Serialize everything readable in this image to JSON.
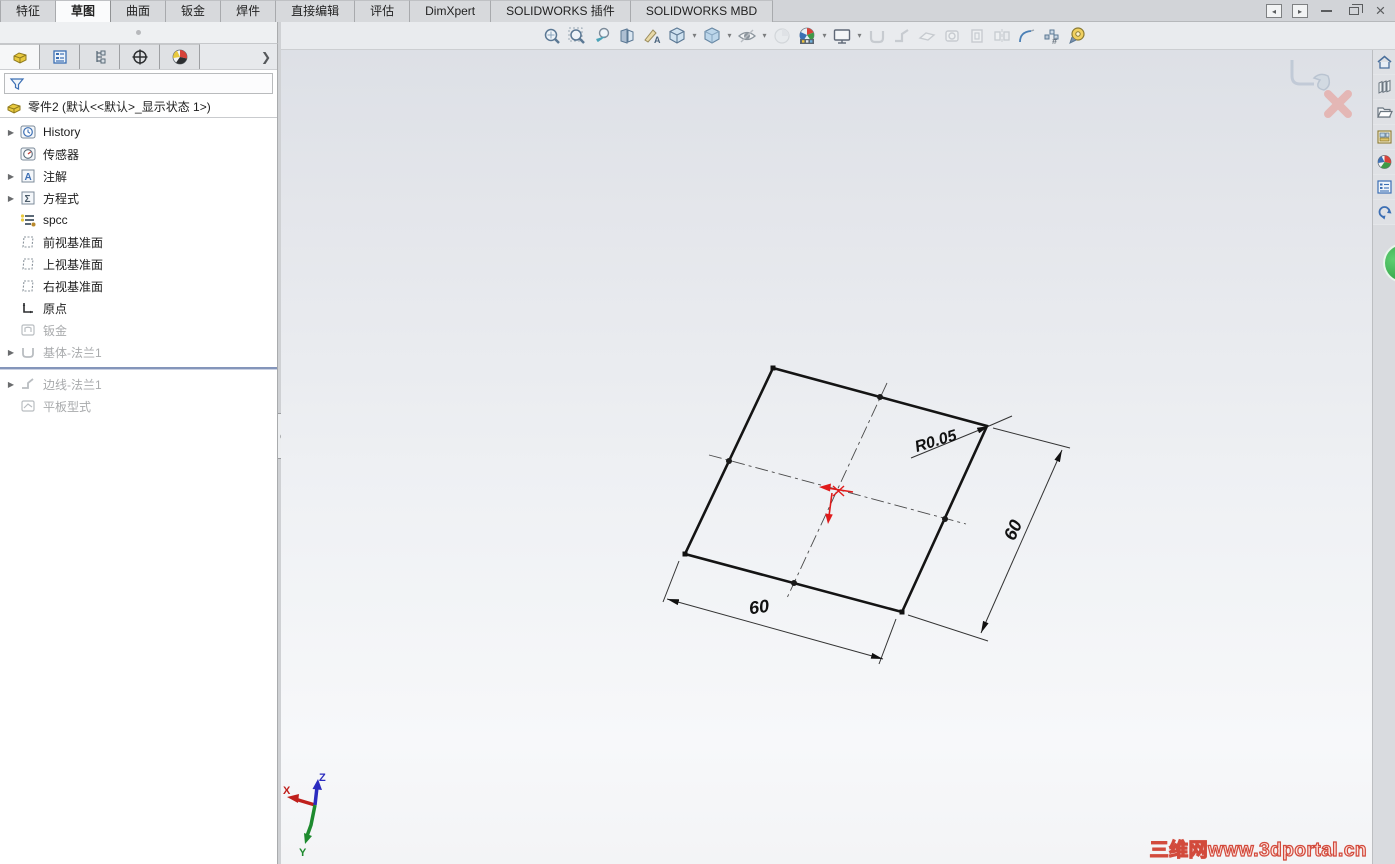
{
  "ribbon": {
    "tabs": [
      {
        "label": "特征"
      },
      {
        "label": "草图",
        "active": true
      },
      {
        "label": "曲面"
      },
      {
        "label": "钣金"
      },
      {
        "label": "焊件"
      },
      {
        "label": "直接编辑"
      },
      {
        "label": "评估"
      },
      {
        "label": "DimXpert"
      },
      {
        "label": "SOLIDWORKS 插件"
      },
      {
        "label": "SOLIDWORKS MBD"
      }
    ]
  },
  "toolbar": {
    "icons": [
      "zoom-to-fit",
      "zoom-to-area",
      "previous-view",
      "section-view",
      "annotation-view",
      "view-orientation",
      "display-style",
      "hide-show-items",
      "edit-appearance",
      "apply-scene",
      "view-settings",
      "base-flange",
      "edge-flange",
      "lofted-bend",
      "forming-tool",
      "extruded-cut",
      "mirror",
      "sketched-bend",
      "pattern",
      "measure"
    ]
  },
  "featuremanager": {
    "title": "零件2 (默认<<默认>_显示状态 1>)",
    "tree": [
      {
        "label": "History"
      },
      {
        "label": "传感器"
      },
      {
        "label": "注解"
      },
      {
        "label": "方程式"
      },
      {
        "label": "spcc"
      },
      {
        "label": "前视基准面"
      },
      {
        "label": "上视基准面"
      },
      {
        "label": "右视基准面"
      },
      {
        "label": "原点"
      },
      {
        "label": "钣金"
      },
      {
        "label": "基体-法兰1"
      },
      {
        "label": "边线-法兰1"
      },
      {
        "label": "平板型式"
      }
    ]
  },
  "sketch": {
    "dim_width": "60",
    "dim_height": "60",
    "dim_radius": "R0.05"
  },
  "triad": {
    "x": "X",
    "y": "Y",
    "z": "Z"
  },
  "watermark": "三维网www.3dportal.cn",
  "colors": {
    "origin_red": "#e01b1b",
    "rollback_bar": "#8495ba",
    "watermark_red": "#d24a3c",
    "badge_green": "#2e9e43"
  }
}
